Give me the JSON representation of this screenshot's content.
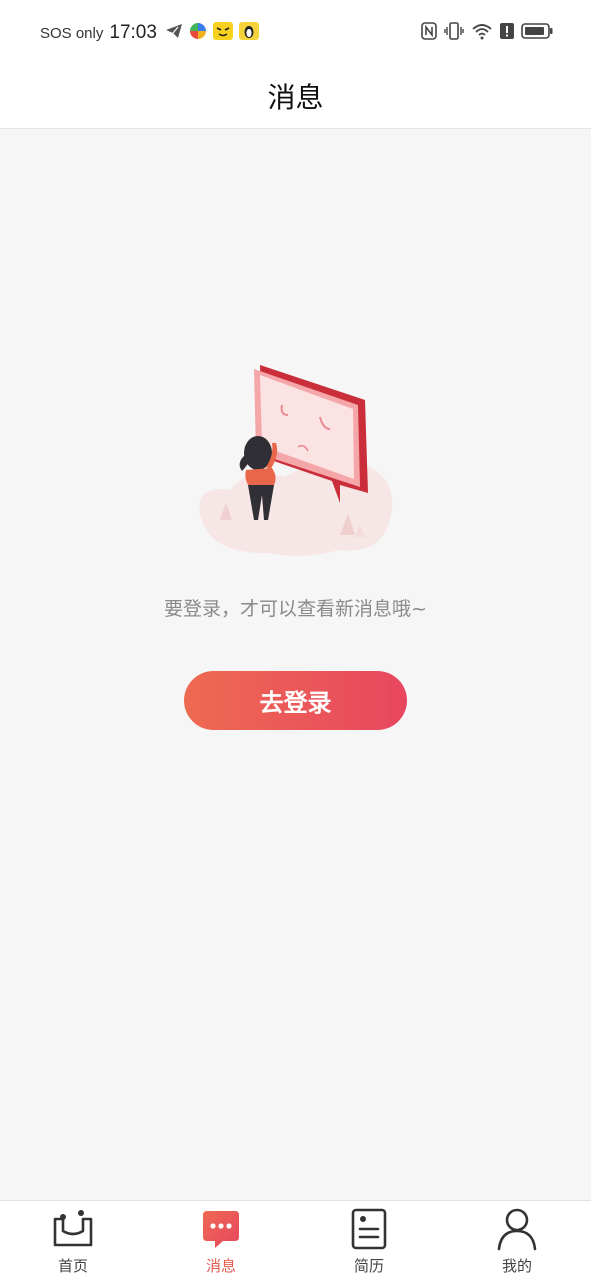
{
  "status_bar": {
    "carrier": "SOS only",
    "time": "17:03",
    "left_icons": [
      "telegram-icon",
      "pinwheel-app-icon",
      "face-app-icon",
      "penguin-app-icon"
    ],
    "right_icons": [
      "nfc-icon",
      "vibrate-icon",
      "wifi-icon",
      "alert-icon",
      "battery-icon"
    ]
  },
  "header": {
    "title": "消息"
  },
  "main": {
    "prompt": "要登录，才可以查看新消息哦~",
    "login_button": "去登录"
  },
  "tabbar": {
    "active": "消息",
    "items": [
      {
        "label": "首页",
        "icon": "home-icon"
      },
      {
        "label": "消息",
        "icon": "message-icon"
      },
      {
        "label": "简历",
        "icon": "resume-icon"
      },
      {
        "label": "我的",
        "icon": "profile-icon"
      }
    ]
  },
  "colors": {
    "accent": "#e65a4f",
    "button_gradient_start": "#ee6a52",
    "button_gradient_end": "#e8465f",
    "background": "#f6f6f6"
  }
}
